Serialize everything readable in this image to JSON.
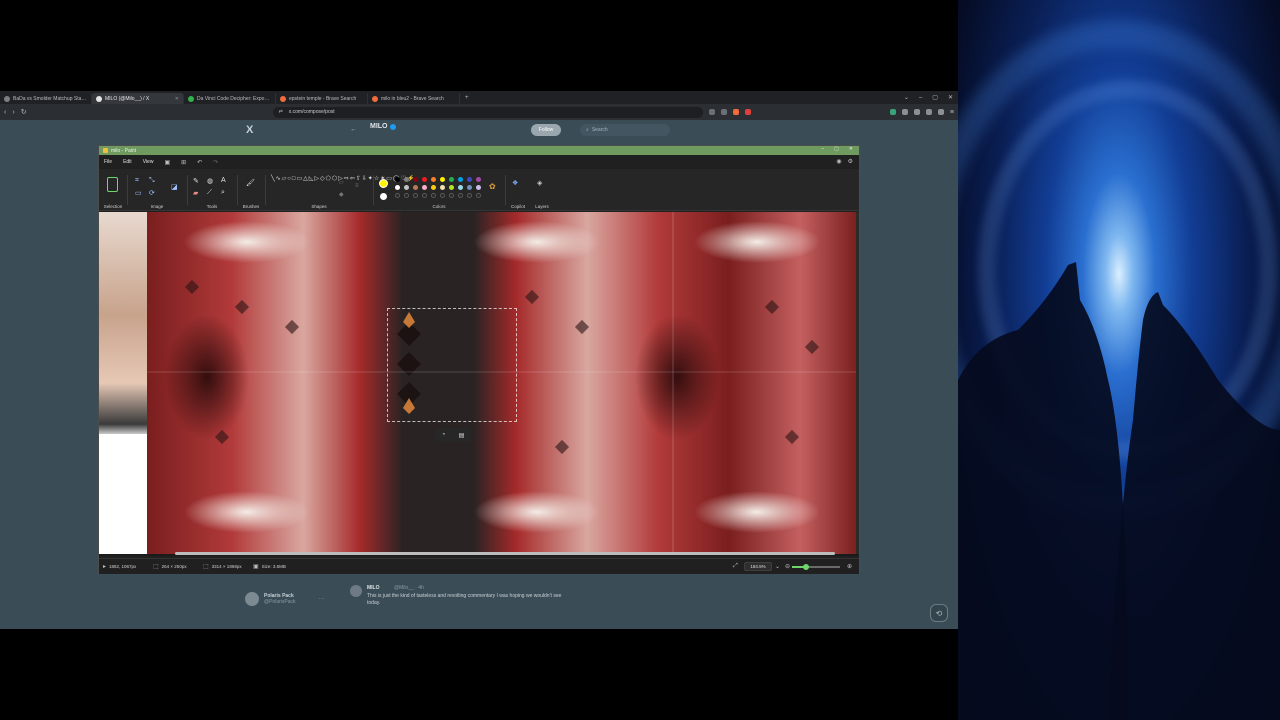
{
  "browser": {
    "tabs": [
      {
        "label": "BaDa vs Smolder Matchup Statistic",
        "fav_color": "#7a7f86"
      },
      {
        "label": "MILO (@Milo__) / X",
        "fav_color": "#e6e6e6"
      },
      {
        "label": "Da Vinci Code Decipher: Exposing Ci",
        "fav_color": "#2fb34a"
      },
      {
        "label": "epstein temple - Brave Search",
        "fav_color": "#f26b3a"
      },
      {
        "label": "milo in bleu2 - Brave Search",
        "fav_color": "#f26b3a"
      }
    ],
    "new_tab_symbol": "+",
    "url": "x.com/compose/post"
  },
  "x_page": {
    "logo": "X",
    "profile_name": "MILO",
    "follow_label": "Follow",
    "search_placeholder": "Search",
    "account_name": "Polaris Pack",
    "account_handle": "@PolarisPack",
    "reply_name": "MILO",
    "reply_handle": "@Milo__ · 4h",
    "reply_text": "This is just the kind of tasteless and revolting commentary I was hoping we wouldn't see today."
  },
  "paint": {
    "title": "milo - Paint",
    "menu": [
      "File",
      "Edit",
      "View"
    ],
    "groups": {
      "selection": "Selection",
      "image": "Image",
      "tools": "Tools",
      "brushes": "Brushes",
      "shapes": "Shapes",
      "colors": "Colors",
      "copilot": "Copilot",
      "layers": "Layers"
    },
    "palette_row1": [
      "#000000",
      "#7f7f7f",
      "#880015",
      "#ed1c24",
      "#ff7f27",
      "#fff200",
      "#22b14c",
      "#00a2e8",
      "#3f48cc",
      "#a349a4"
    ],
    "palette_row2": [
      "#ffffff",
      "#c3c3c3",
      "#b97a57",
      "#ffaec9",
      "#ffc90e",
      "#efe4b0",
      "#b5e61d",
      "#99d9ea",
      "#7092be",
      "#c8bfe7"
    ],
    "primary_color": "#fff200",
    "secondary_color": "#ffffff",
    "status": {
      "cursor": "1882, 1067px",
      "selection_size": "264 × 250px",
      "image_size": "3314 × 1869px",
      "file_size": "Size: 3.6MB",
      "zoom": "184.5%",
      "zoom_fraction": 0.3
    }
  }
}
